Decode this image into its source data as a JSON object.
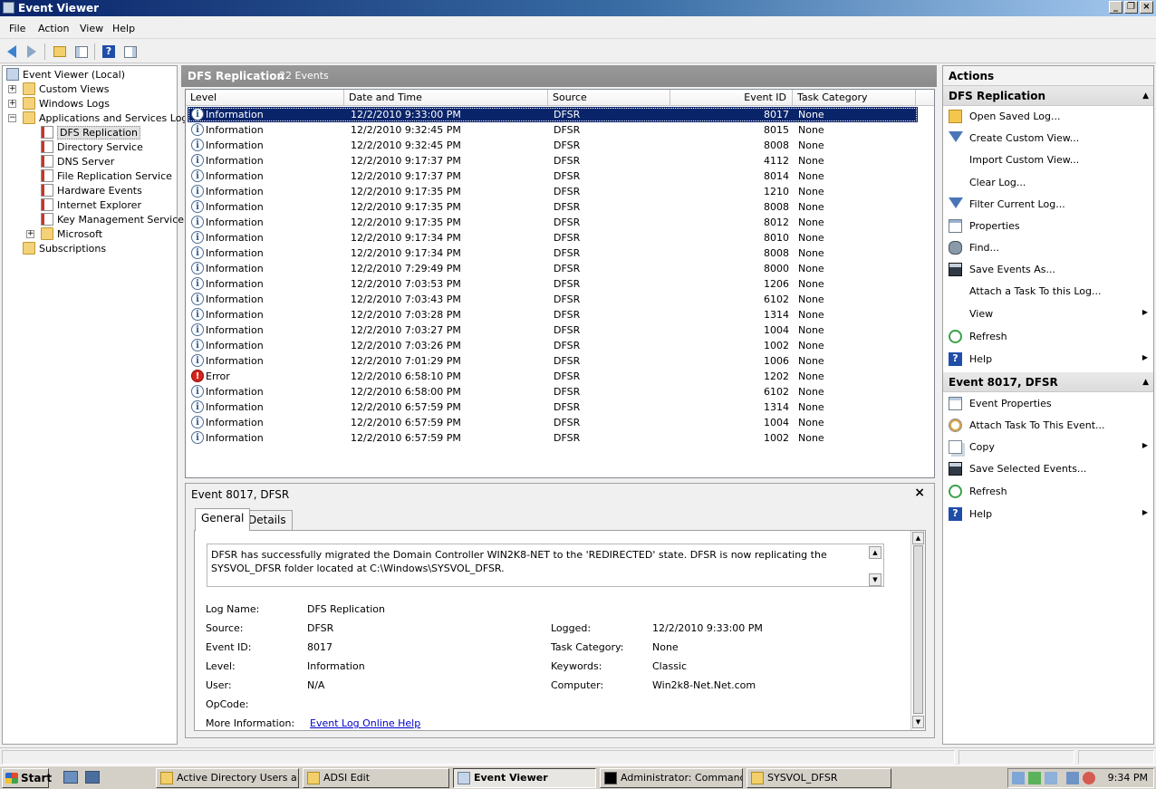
{
  "window": {
    "title": "Event Viewer"
  },
  "menubar": [
    "File",
    "Action",
    "View",
    "Help"
  ],
  "tree": {
    "root": "Event Viewer (Local)",
    "nodes": [
      "Custom Views",
      "Windows Logs",
      "Applications and Services Logs"
    ],
    "app_logs": [
      "DFS Replication",
      "Directory Service",
      "DNS Server",
      "File Replication Service",
      "Hardware Events",
      "Internet Explorer",
      "Key Management Service",
      "Microsoft"
    ],
    "subscriptions": "Subscriptions",
    "selected": "DFS Replication"
  },
  "events_panel": {
    "title": "DFS Replication",
    "count": "22 Events",
    "columns": [
      "Level",
      "Date and Time",
      "Source",
      "Event ID",
      "Task Category"
    ],
    "rows": [
      {
        "level": "Information",
        "date": "12/2/2010 9:33:00 PM",
        "source": "DFSR",
        "id": "8017",
        "task": "None",
        "selected": true
      },
      {
        "level": "Information",
        "date": "12/2/2010 9:32:45 PM",
        "source": "DFSR",
        "id": "8015",
        "task": "None"
      },
      {
        "level": "Information",
        "date": "12/2/2010 9:32:45 PM",
        "source": "DFSR",
        "id": "8008",
        "task": "None"
      },
      {
        "level": "Information",
        "date": "12/2/2010 9:17:37 PM",
        "source": "DFSR",
        "id": "4112",
        "task": "None"
      },
      {
        "level": "Information",
        "date": "12/2/2010 9:17:37 PM",
        "source": "DFSR",
        "id": "8014",
        "task": "None"
      },
      {
        "level": "Information",
        "date": "12/2/2010 9:17:35 PM",
        "source": "DFSR",
        "id": "1210",
        "task": "None"
      },
      {
        "level": "Information",
        "date": "12/2/2010 9:17:35 PM",
        "source": "DFSR",
        "id": "8008",
        "task": "None"
      },
      {
        "level": "Information",
        "date": "12/2/2010 9:17:35 PM",
        "source": "DFSR",
        "id": "8012",
        "task": "None"
      },
      {
        "level": "Information",
        "date": "12/2/2010 9:17:34 PM",
        "source": "DFSR",
        "id": "8010",
        "task": "None"
      },
      {
        "level": "Information",
        "date": "12/2/2010 9:17:34 PM",
        "source": "DFSR",
        "id": "8008",
        "task": "None"
      },
      {
        "level": "Information",
        "date": "12/2/2010 7:29:49 PM",
        "source": "DFSR",
        "id": "8000",
        "task": "None"
      },
      {
        "level": "Information",
        "date": "12/2/2010 7:03:53 PM",
        "source": "DFSR",
        "id": "1206",
        "task": "None"
      },
      {
        "level": "Information",
        "date": "12/2/2010 7:03:43 PM",
        "source": "DFSR",
        "id": "6102",
        "task": "None"
      },
      {
        "level": "Information",
        "date": "12/2/2010 7:03:28 PM",
        "source": "DFSR",
        "id": "1314",
        "task": "None"
      },
      {
        "level": "Information",
        "date": "12/2/2010 7:03:27 PM",
        "source": "DFSR",
        "id": "1004",
        "task": "None"
      },
      {
        "level": "Information",
        "date": "12/2/2010 7:03:26 PM",
        "source": "DFSR",
        "id": "1002",
        "task": "None"
      },
      {
        "level": "Information",
        "date": "12/2/2010 7:01:29 PM",
        "source": "DFSR",
        "id": "1006",
        "task": "None"
      },
      {
        "level": "Error",
        "date": "12/2/2010 6:58:10 PM",
        "source": "DFSR",
        "id": "1202",
        "task": "None"
      },
      {
        "level": "Information",
        "date": "12/2/2010 6:58:00 PM",
        "source": "DFSR",
        "id": "6102",
        "task": "None"
      },
      {
        "level": "Information",
        "date": "12/2/2010 6:57:59 PM",
        "source": "DFSR",
        "id": "1314",
        "task": "None"
      },
      {
        "level": "Information",
        "date": "12/2/2010 6:57:59 PM",
        "source": "DFSR",
        "id": "1004",
        "task": "None"
      },
      {
        "level": "Information",
        "date": "12/2/2010 6:57:59 PM",
        "source": "DFSR",
        "id": "1002",
        "task": "None"
      }
    ]
  },
  "details": {
    "title": "Event 8017, DFSR",
    "close": "×",
    "tabs": [
      "General",
      "Details"
    ],
    "message": "DFSR has successfully migrated the Domain Controller WIN2K8-NET to the 'REDIRECTED' state. DFSR is now replicating the SYSVOL_DFSR folder located at C:\\Windows\\SYSVOL_DFSR.",
    "labels": {
      "log_name": "Log Name:",
      "source": "Source:",
      "event_id": "Event ID:",
      "level": "Level:",
      "user": "User:",
      "opcode": "OpCode:",
      "more_info": "More Information:",
      "logged": "Logged:",
      "task_category": "Task Category:",
      "keywords": "Keywords:",
      "computer": "Computer:"
    },
    "values": {
      "log_name": "DFS Replication",
      "source": "DFSR",
      "event_id": "8017",
      "level": "Information",
      "user": "N/A",
      "opcode": "",
      "more_info_link": "Event Log Online Help",
      "logged": "12/2/2010 9:33:00 PM",
      "task_category": "None",
      "keywords": "Classic",
      "computer": "Win2k8-Net.Net.com"
    }
  },
  "actions": {
    "header": "Actions",
    "section1": {
      "title": "DFS Replication",
      "items": [
        {
          "label": "Open Saved Log...",
          "icon": "open-folder-icon"
        },
        {
          "label": "Create Custom View...",
          "icon": "filter-icon"
        },
        {
          "label": "Import Custom View...",
          "icon": ""
        },
        {
          "label": "Clear Log...",
          "icon": ""
        },
        {
          "label": "Filter Current Log...",
          "icon": "filter-icon"
        },
        {
          "label": "Properties",
          "icon": "properties-icon"
        },
        {
          "label": "Find...",
          "icon": "binoculars-icon"
        },
        {
          "label": "Save Events As...",
          "icon": "save-icon"
        },
        {
          "label": "Attach a Task To this Log...",
          "icon": ""
        },
        {
          "label": "View",
          "icon": "",
          "submenu": true
        },
        {
          "label": "Refresh",
          "icon": "refresh-icon"
        },
        {
          "label": "Help",
          "icon": "help-icon",
          "submenu": true
        }
      ]
    },
    "section2": {
      "title": "Event 8017, DFSR",
      "items": [
        {
          "label": "Event Properties",
          "icon": "event-properties-icon"
        },
        {
          "label": "Attach Task To This Event...",
          "icon": "task-icon"
        },
        {
          "label": "Copy",
          "icon": "copy-icon",
          "submenu": true
        },
        {
          "label": "Save Selected Events...",
          "icon": "save-icon"
        },
        {
          "label": "Refresh",
          "icon": "refresh-icon"
        },
        {
          "label": "Help",
          "icon": "help-icon",
          "submenu": true
        }
      ]
    }
  },
  "taskbar": {
    "start": "Start",
    "tasks": [
      "Active Directory Users a...",
      "ADSI Edit",
      "Event Viewer",
      "Administrator: Command...",
      "SYSVOL_DFSR"
    ],
    "active_task": "Event Viewer",
    "clock": "9:34 PM"
  },
  "colors": {
    "selection": "#0a246a",
    "error": "#d6231c",
    "link": "#0000cc"
  }
}
